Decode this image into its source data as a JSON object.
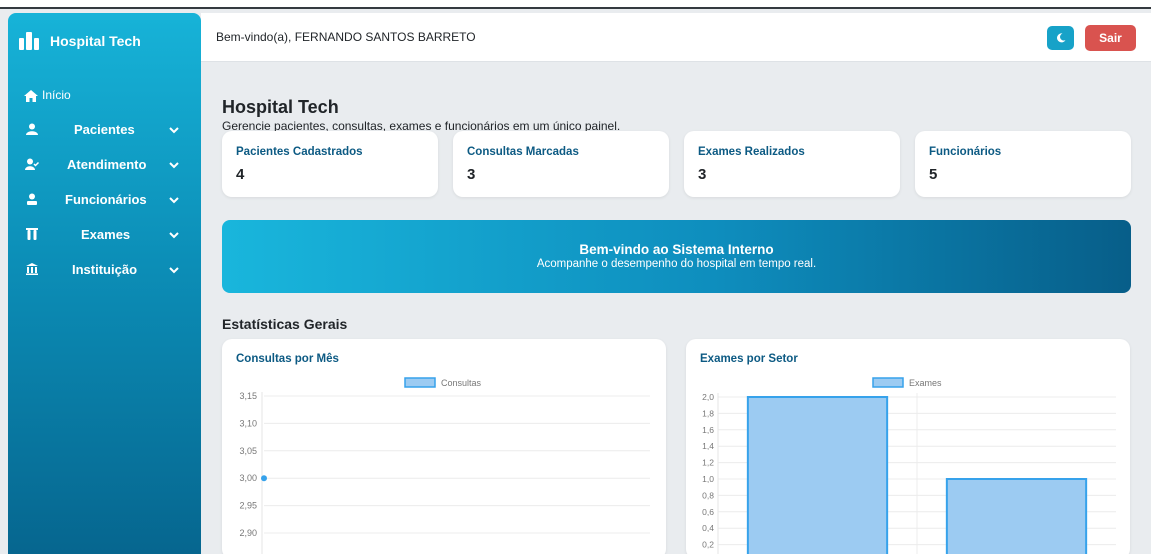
{
  "brand": {
    "name": "Hospital Tech"
  },
  "sidebar": {
    "items": [
      {
        "label": "Início",
        "icon": "home-icon"
      },
      {
        "label": "Pacientes",
        "icon": "user-icon"
      },
      {
        "label": "Atendimento",
        "icon": "user-check-icon"
      },
      {
        "label": "Funcionários",
        "icon": "id-badge-icon"
      },
      {
        "label": "Exames",
        "icon": "vials-icon"
      },
      {
        "label": "Instituição",
        "icon": "institution-icon"
      }
    ]
  },
  "header": {
    "welcome": "Bem-vindo(a), FERNANDO SANTOS BARRETO",
    "logout_label": "Sair"
  },
  "main": {
    "title": "Hospital Tech",
    "subtitle": "Gerencie pacientes, consultas, exames e funcionários em um único painel.",
    "cards": [
      {
        "label": "Pacientes Cadastrados",
        "value": "4"
      },
      {
        "label": "Consultas Marcadas",
        "value": "3"
      },
      {
        "label": "Exames Realizados",
        "value": "3"
      },
      {
        "label": "Funcionários",
        "value": "5"
      }
    ],
    "banner": {
      "title": "Bem-vindo ao Sistema Interno",
      "subtitle": "Acompanhe o desempenho do hospital em tempo real."
    },
    "stats_title": "Estatísticas Gerais"
  },
  "colors": {
    "accent": "#17a2c8",
    "danger": "#d9534f",
    "card_label": "#0c5a83",
    "bar_fill": "#9ccbf2",
    "bar_border": "#36a2eb"
  },
  "chart_data": [
    {
      "type": "line",
      "title": "Consultas por Mês",
      "series": [
        {
          "name": "Consultas",
          "values": [
            3.0
          ]
        }
      ],
      "y_ticks": [
        "3,15",
        "3,10",
        "3,05",
        "3,00",
        "2,95",
        "2,90"
      ],
      "ylim": [
        2.85,
        3.15
      ],
      "legend": "top"
    },
    {
      "type": "bar",
      "title": "Exames por Setor",
      "categories": [
        "",
        ""
      ],
      "series": [
        {
          "name": "Exames",
          "values": [
            2,
            1
          ]
        }
      ],
      "y_ticks": [
        "2,0",
        "1,8",
        "1,6",
        "1,4",
        "1,2",
        "1,0",
        "0,8",
        "0,6",
        "0,4",
        "0,2"
      ],
      "ylim": [
        0,
        2
      ],
      "legend": "top"
    }
  ]
}
